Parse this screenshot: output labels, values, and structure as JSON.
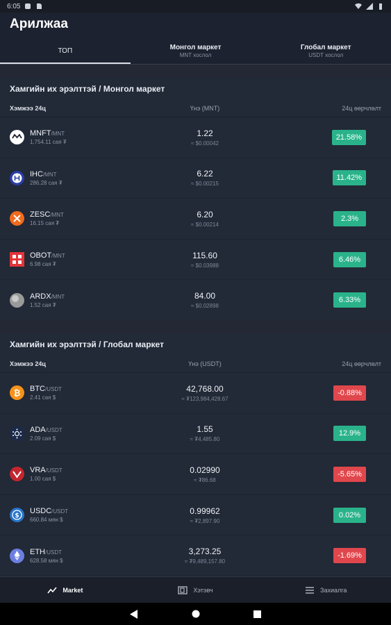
{
  "status_bar": {
    "time": "6:05"
  },
  "app": {
    "title": "Арилжаа"
  },
  "tabs": [
    {
      "label": "ТОП",
      "sub": ""
    },
    {
      "label": "Монгол маркет",
      "sub": "MNT хослол"
    },
    {
      "label": "Глобал маркет",
      "sub": "USDT хослол"
    }
  ],
  "mongol": {
    "title": "Хамгийн их эрэлттэй / Монгол маркет",
    "head": {
      "name": "Хэмжээ 24ц",
      "price": "Үнэ (MNT)",
      "change": "24ц өөрчлөлт"
    },
    "rows": [
      {
        "sym": "MNFT",
        "pair": "/MNT",
        "vol": "1,754.11 сая ₮",
        "price": "1.22",
        "sub": "≈ $0.00042",
        "change": "21.58%",
        "dir": "up",
        "icon": "mnft-icon",
        "color": "#ffffff"
      },
      {
        "sym": "IHC",
        "pair": "/MNT",
        "vol": "286.28 сая ₮",
        "price": "6.22",
        "sub": "≈ $0.00215",
        "change": "11.42%",
        "dir": "up",
        "icon": "ihc-icon",
        "color": "#2a3ea8"
      },
      {
        "sym": "ZESC",
        "pair": "/MNT",
        "vol": "16.15 сая ₮",
        "price": "6.20",
        "sub": "≈ $0.00214",
        "change": "2.3%",
        "dir": "up",
        "icon": "zesc-icon",
        "color": "#f26a1b"
      },
      {
        "sym": "OBOT",
        "pair": "/MNT",
        "vol": "6.98 сая ₮",
        "price": "115.60",
        "sub": "≈ $0.03988",
        "change": "6.46%",
        "dir": "up",
        "icon": "obot-icon",
        "color": "#e0353a"
      },
      {
        "sym": "ARDX",
        "pair": "/MNT",
        "vol": "1.52 сая ₮",
        "price": "84.00",
        "sub": "≈ $0.02898",
        "change": "6.33%",
        "dir": "up",
        "icon": "ardx-icon",
        "color": "#9a9a9a"
      }
    ]
  },
  "global": {
    "title": "Хамгийн их эрэлттэй / Глобал маркет",
    "head": {
      "name": "Хэмжээ 24ц",
      "price": "Үнэ (USDT)",
      "change": "24ц өөрчлөлт"
    },
    "rows": [
      {
        "sym": "BTC",
        "pair": "/USDT",
        "vol": "2.41 сая $",
        "price": "42,768.00",
        "sub": "≈ ₮123,984,428.67",
        "change": "-0.88%",
        "dir": "down",
        "icon": "btc-icon",
        "color": "#f7931a"
      },
      {
        "sym": "ADA",
        "pair": "/USDT",
        "vol": "2.09 сая $",
        "price": "1.55",
        "sub": "≈ ₮4,485.80",
        "change": "12.9%",
        "dir": "up",
        "icon": "ada-icon",
        "color": "#1b2a4a"
      },
      {
        "sym": "VRA",
        "pair": "/USDT",
        "vol": "1.00 сая $",
        "price": "0.02990",
        "sub": "≈ ₮86.68",
        "change": "-5.65%",
        "dir": "down",
        "icon": "vra-icon",
        "color": "#c4262e"
      },
      {
        "sym": "USDC",
        "pair": "/USDT",
        "vol": "660.84 мян $",
        "price": "0.99962",
        "sub": "≈ ₮2,897.90",
        "change": "0.02%",
        "dir": "up",
        "icon": "usdc-icon",
        "color": "#2775ca"
      },
      {
        "sym": "ETH",
        "pair": "/USDT",
        "vol": "628.58 мян $",
        "price": "3,273.25",
        "sub": "≈ ₮9,489,157.80",
        "change": "-1.69%",
        "dir": "down",
        "icon": "eth-icon",
        "color": "#6c7fe0"
      }
    ]
  },
  "bottom_nav": [
    {
      "label": "Market",
      "icon": "trend-icon"
    },
    {
      "label": "Хэтэвч",
      "icon": "wallet-icon"
    },
    {
      "label": "Захиалга",
      "icon": "orders-icon"
    }
  ],
  "colors": {
    "up": "#2ab38a",
    "down": "#e0474c",
    "background": "#2b3140"
  }
}
